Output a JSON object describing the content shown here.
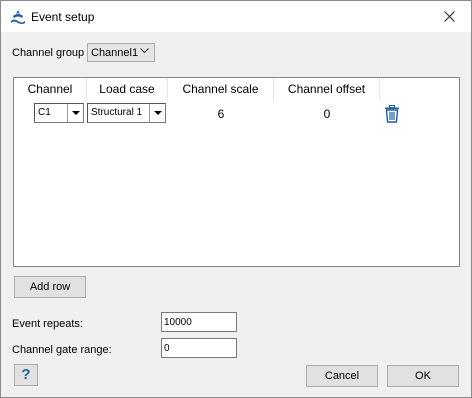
{
  "window": {
    "title": "Event setup",
    "icons": {
      "app": "app-logo-icon",
      "close": "close-icon"
    }
  },
  "channel_group": {
    "label": "Channel group",
    "selected": "Channel1"
  },
  "table": {
    "columns": [
      "Channel",
      "Load case",
      "Channel scale",
      "Channel offset"
    ],
    "rows": [
      {
        "channel": "C1",
        "load_case": "Structural 1",
        "scale": "6",
        "offset": "0",
        "delete_icon": "trash-icon"
      }
    ]
  },
  "add_row_label": "Add row",
  "event_repeats": {
    "label": "Event repeats:",
    "value": "10000"
  },
  "gate_range": {
    "label": "Channel gate range:",
    "value": "0"
  },
  "footer": {
    "help_label": "?",
    "cancel_label": "Cancel",
    "ok_label": "OK"
  },
  "colors": {
    "accent": "#1f5f9f",
    "window_bg": "#f0f0f0"
  }
}
